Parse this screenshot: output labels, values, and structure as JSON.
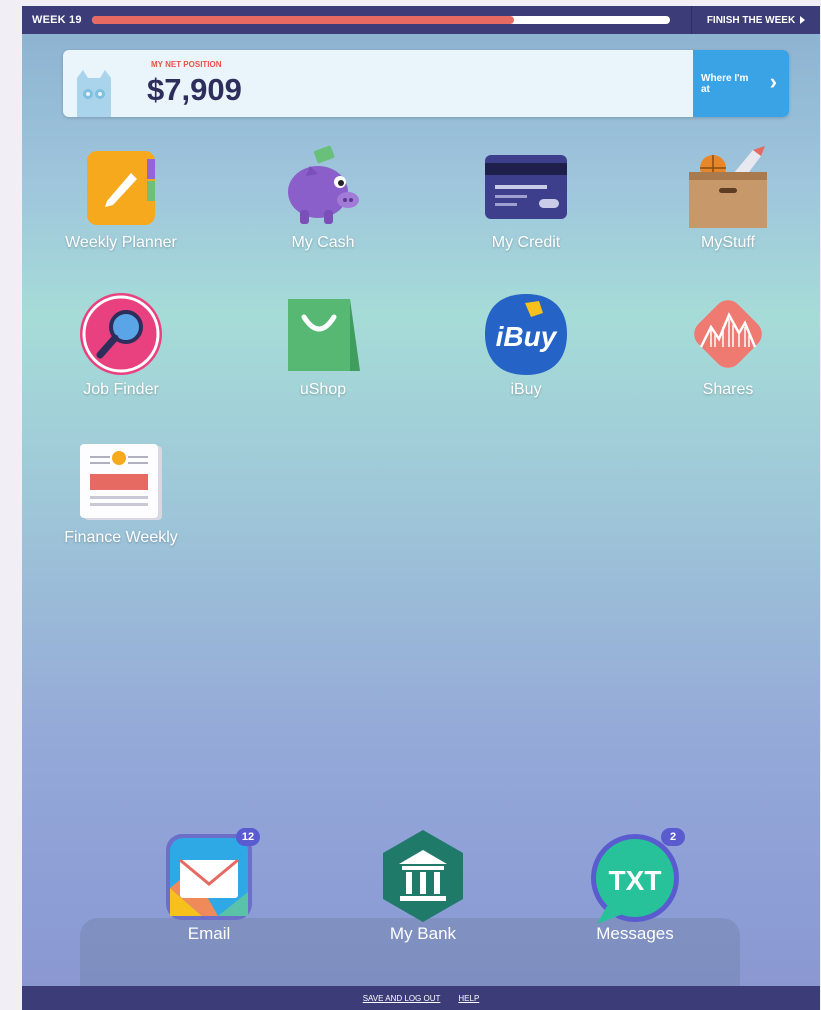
{
  "topbar": {
    "week_label": "WEEK 19",
    "progress_percent": 73,
    "finish_label": "FINISH THE WEEK"
  },
  "net_position": {
    "label": "MY NET POSITION",
    "value": "$7,909",
    "where_label": "Where I'm at"
  },
  "apps": [
    {
      "label": "Weekly Planner",
      "icon": "pencil-notebook-icon"
    },
    {
      "label": "My Cash",
      "icon": "piggy-bank-icon"
    },
    {
      "label": "My Credit",
      "icon": "credit-card-icon"
    },
    {
      "label": "MyStuff",
      "icon": "box-icon"
    },
    {
      "label": "Job Finder",
      "icon": "magnifier-icon"
    },
    {
      "label": "uShop",
      "icon": "shopping-bag-icon"
    },
    {
      "label": "iBuy",
      "icon": "ibuy-logo-icon",
      "logo_text": "iBuy"
    },
    {
      "label": "Shares",
      "icon": "shares-chart-icon"
    },
    {
      "label": "Finance Weekly",
      "icon": "newspaper-icon"
    }
  ],
  "dock": [
    {
      "label": "Email",
      "icon": "envelope-icon",
      "badge": "12"
    },
    {
      "label": "My Bank",
      "icon": "bank-icon"
    },
    {
      "label": "Messages",
      "icon": "txt-bubble-icon",
      "badge": "2",
      "bubble_text": "TXT"
    }
  ],
  "footer": {
    "save_label": "SAVE AND LOG OUT",
    "help_label": "HELP"
  },
  "colors": {
    "bar": "#3b3c78",
    "accent_red": "#e66a62",
    "accent_blue": "#3aa3e6",
    "badge": "#5b5bd0"
  }
}
